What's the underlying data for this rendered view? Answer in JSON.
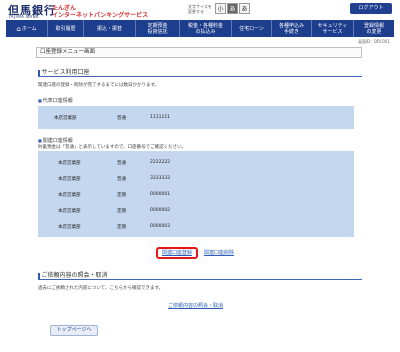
{
  "header": {
    "logo_main": "但馬銀行",
    "logo_sub": "TAJIMA BANK",
    "service_line1": "たんぎん",
    "service_line2": "インターネットバンキングサービス",
    "fontsize_label": "文字サイズを変更する",
    "fontsize_small": "小",
    "fontsize_mid": "あ",
    "fontsize_large": "あ",
    "logout_label": "ログアウト"
  },
  "nav": [
    {
      "label": "ホーム"
    },
    {
      "label": "取引履歴"
    },
    {
      "label": "振込・振替"
    },
    {
      "label": "定期預金\n投資信託"
    },
    {
      "label": "税金・各種料金\nの払込み"
    },
    {
      "label": "住宅ローン"
    },
    {
      "label": "各種申込み\n手続き"
    },
    {
      "label": "セキュリティ\nサービス"
    },
    {
      "label": "登録情報\nの変更"
    }
  ],
  "torihiki_no": "画面ID：BRC001",
  "page_title": "口座登録メニュー画面",
  "service_section": {
    "heading": "サービス利用口座",
    "description": "関連口座の登録・削除が完了するまでには数日かかります。",
    "rep_heading": "代表口座情報",
    "rep_account": {
      "branch": "本店営業部",
      "type": "普通",
      "number": "1111111"
    },
    "related_heading": "関連口座情報",
    "related_note": "貯蓄預金は「普通」と表示していますので、口座番号でご確認ください。",
    "related_accounts": [
      {
        "branch": "本店営業部",
        "type": "普通",
        "number": "2222222"
      },
      {
        "branch": "本店営業部",
        "type": "普通",
        "number": "3333333"
      },
      {
        "branch": "本店営業部",
        "type": "定期",
        "number": "0000001"
      },
      {
        "branch": "本店営業部",
        "type": "定期",
        "number": "0000002"
      },
      {
        "branch": "本店営業部",
        "type": "定期",
        "number": "0000003"
      }
    ],
    "register_link": "関連口座登録",
    "delete_link": "関連口座削除"
  },
  "inquiry_section": {
    "heading": "ご依頼内容の照会・取消",
    "description": "過去にご依頼された内容について、こちらから確認できます。",
    "link": "ご依頼内容の照会・取消"
  },
  "top_button": "トップページへ"
}
